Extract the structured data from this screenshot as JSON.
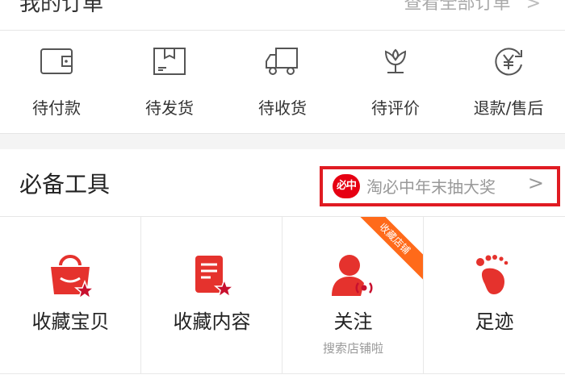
{
  "header": {
    "title": "我的订单",
    "view_all": "查看全部订单",
    "chevron": ">"
  },
  "orders": [
    {
      "label": "待付款",
      "icon": "wallet-icon"
    },
    {
      "label": "待发货",
      "icon": "package-icon"
    },
    {
      "label": "待收货",
      "icon": "delivery-truck-icon"
    },
    {
      "label": "待评价",
      "icon": "tulip-icon"
    },
    {
      "label": "退款/售后",
      "icon": "refund-yuan-icon"
    }
  ],
  "tools": {
    "title": "必备工具",
    "promo": {
      "badge": "必中",
      "text": "淘必中年末抽大奖",
      "chevron": ">",
      "highlight_color": "#e01b22"
    },
    "items": [
      {
        "label": "收藏宝贝",
        "icon": "shopping-bag-star-icon"
      },
      {
        "label": "收藏内容",
        "icon": "document-star-icon"
      },
      {
        "label": "关注",
        "sublabel": "搜索店铺啦",
        "icon": "person-broadcast-icon",
        "ribbon": "收藏店铺"
      },
      {
        "label": "足迹",
        "icon": "footprint-icon"
      }
    ]
  },
  "colors": {
    "accent_red": "#e5322d",
    "ribbon_orange": "#ff6a1a",
    "muted_text": "#999999"
  }
}
